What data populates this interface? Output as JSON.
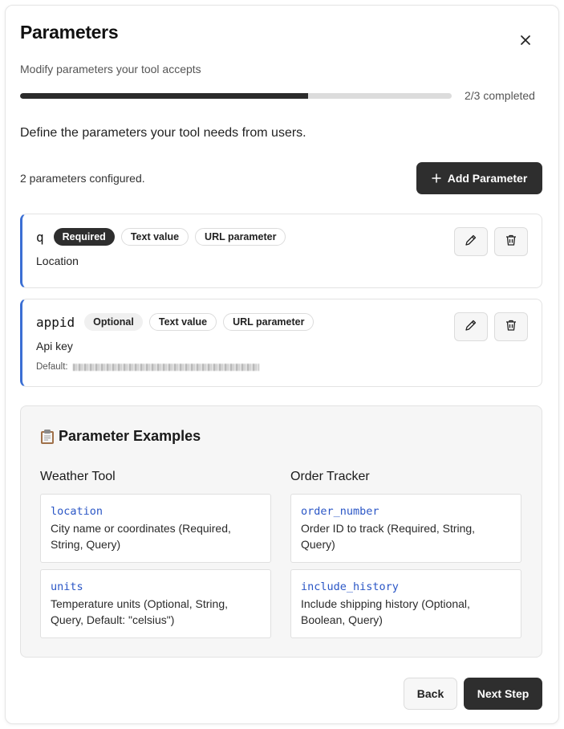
{
  "dialog": {
    "title": "Parameters",
    "subtitle": "Modify parameters your tool accepts",
    "close_icon": "close-icon"
  },
  "progress": {
    "fraction": 0.667,
    "text": "2/3 completed"
  },
  "intro": "Define the parameters your tool needs from users.",
  "count_text": "2 parameters configured.",
  "add_button": {
    "icon": "plus-icon",
    "label": "Add Parameter"
  },
  "parameters": [
    {
      "name": "q",
      "badges": [
        "Required",
        "Text value",
        "URL parameter"
      ],
      "description": "Location",
      "edit_icon": "pencil-icon",
      "delete_icon": "trash-icon"
    },
    {
      "name": "appid",
      "badges": [
        "Optional",
        "Text value",
        "URL parameter"
      ],
      "description": "Api key",
      "default_label": "Default:",
      "edit_icon": "pencil-icon",
      "delete_icon": "trash-icon"
    }
  ],
  "examples": {
    "icon": "clipboard-icon",
    "title": "Parameter Examples",
    "columns": [
      {
        "title": "Weather Tool",
        "items": [
          {
            "code": "location",
            "desc": "City name or coordinates (Required, String, Query)"
          },
          {
            "code": "units",
            "desc": "Temperature units (Optional, String, Query, Default: \"celsius\")"
          }
        ]
      },
      {
        "title": "Order Tracker",
        "items": [
          {
            "code": "order_number",
            "desc": "Order ID to track (Required, String, Query)"
          },
          {
            "code": "include_history",
            "desc": "Include shipping history (Optional, Boolean, Query)"
          }
        ]
      }
    ]
  },
  "footer": {
    "back_label": "Back",
    "next_label": "Next Step"
  },
  "colors": {
    "accent": "#3b6fd4",
    "dark": "#2e2e2e",
    "code": "#2a56c6"
  }
}
